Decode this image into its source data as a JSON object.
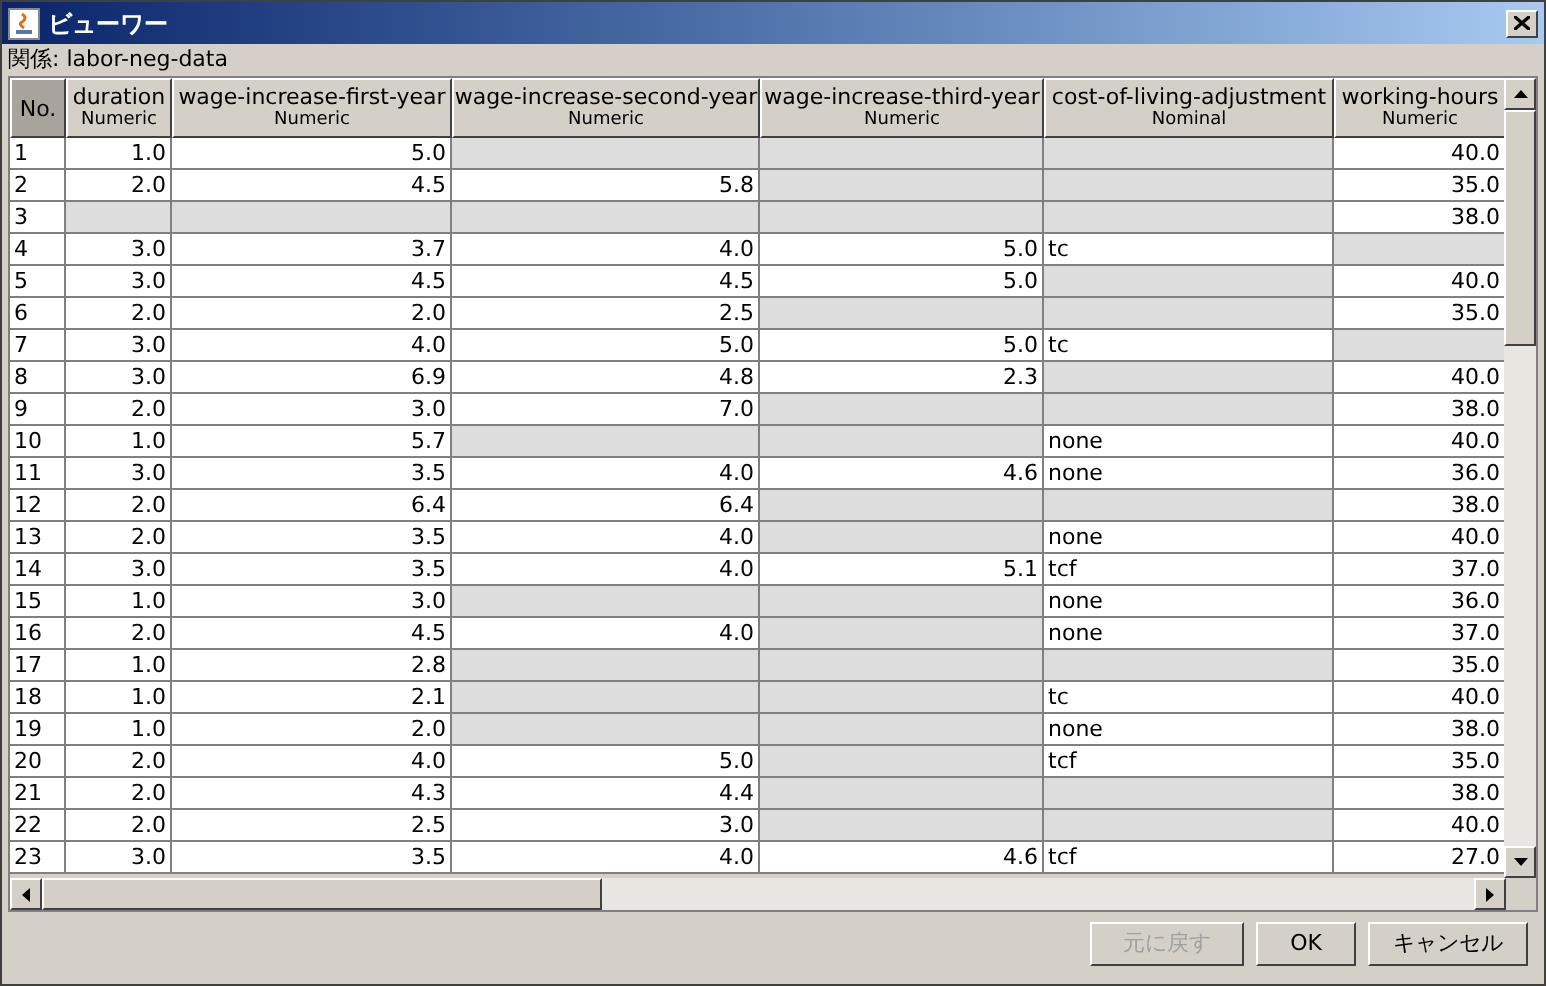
{
  "window": {
    "title": "ビューワー"
  },
  "relation": "関係: labor-neg-data",
  "table": {
    "columns": [
      {
        "name": "No.",
        "kind": "index"
      },
      {
        "name": "duration",
        "type": "Numeric",
        "kind": "numeric"
      },
      {
        "name": "wage-increase-first-year",
        "type": "Numeric",
        "kind": "numeric"
      },
      {
        "name": "wage-increase-second-year",
        "type": "Numeric",
        "kind": "numeric"
      },
      {
        "name": "wage-increase-third-year",
        "type": "Numeric",
        "kind": "numeric"
      },
      {
        "name": "cost-of-living-adjustment",
        "type": "Nominal",
        "kind": "nominal"
      },
      {
        "name": "working-hours",
        "type": "Numeric",
        "kind": "numeric"
      }
    ],
    "rows": [
      [
        "1",
        "1.0",
        "5.0",
        null,
        null,
        null,
        "40.0"
      ],
      [
        "2",
        "2.0",
        "4.5",
        "5.8",
        null,
        null,
        "35.0"
      ],
      [
        "3",
        null,
        null,
        null,
        null,
        null,
        "38.0"
      ],
      [
        "4",
        "3.0",
        "3.7",
        "4.0",
        "5.0",
        "tc",
        null
      ],
      [
        "5",
        "3.0",
        "4.5",
        "4.5",
        "5.0",
        null,
        "40.0"
      ],
      [
        "6",
        "2.0",
        "2.0",
        "2.5",
        null,
        null,
        "35.0"
      ],
      [
        "7",
        "3.0",
        "4.0",
        "5.0",
        "5.0",
        "tc",
        null
      ],
      [
        "8",
        "3.0",
        "6.9",
        "4.8",
        "2.3",
        null,
        "40.0"
      ],
      [
        "9",
        "2.0",
        "3.0",
        "7.0",
        null,
        null,
        "38.0"
      ],
      [
        "10",
        "1.0",
        "5.7",
        null,
        null,
        "none",
        "40.0"
      ],
      [
        "11",
        "3.0",
        "3.5",
        "4.0",
        "4.6",
        "none",
        "36.0"
      ],
      [
        "12",
        "2.0",
        "6.4",
        "6.4",
        null,
        null,
        "38.0"
      ],
      [
        "13",
        "2.0",
        "3.5",
        "4.0",
        null,
        "none",
        "40.0"
      ],
      [
        "14",
        "3.0",
        "3.5",
        "4.0",
        "5.1",
        "tcf",
        "37.0"
      ],
      [
        "15",
        "1.0",
        "3.0",
        null,
        null,
        "none",
        "36.0"
      ],
      [
        "16",
        "2.0",
        "4.5",
        "4.0",
        null,
        "none",
        "37.0"
      ],
      [
        "17",
        "1.0",
        "2.8",
        null,
        null,
        null,
        "35.0"
      ],
      [
        "18",
        "1.0",
        "2.1",
        null,
        null,
        "tc",
        "40.0"
      ],
      [
        "19",
        "1.0",
        "2.0",
        null,
        null,
        "none",
        "38.0"
      ],
      [
        "20",
        "2.0",
        "4.0",
        "5.0",
        null,
        "tcf",
        "35.0"
      ],
      [
        "21",
        "2.0",
        "4.3",
        "4.4",
        null,
        null,
        "38.0"
      ],
      [
        "22",
        "2.0",
        "2.5",
        "3.0",
        null,
        null,
        "40.0"
      ],
      [
        "23",
        "3.0",
        "3.5",
        "4.0",
        "4.6",
        "tcf",
        "27.0"
      ]
    ]
  },
  "buttons": [
    {
      "label": "元に戻す",
      "disabled": true
    },
    {
      "label": "OK",
      "disabled": false
    },
    {
      "label": "キャンセル",
      "disabled": false
    }
  ]
}
